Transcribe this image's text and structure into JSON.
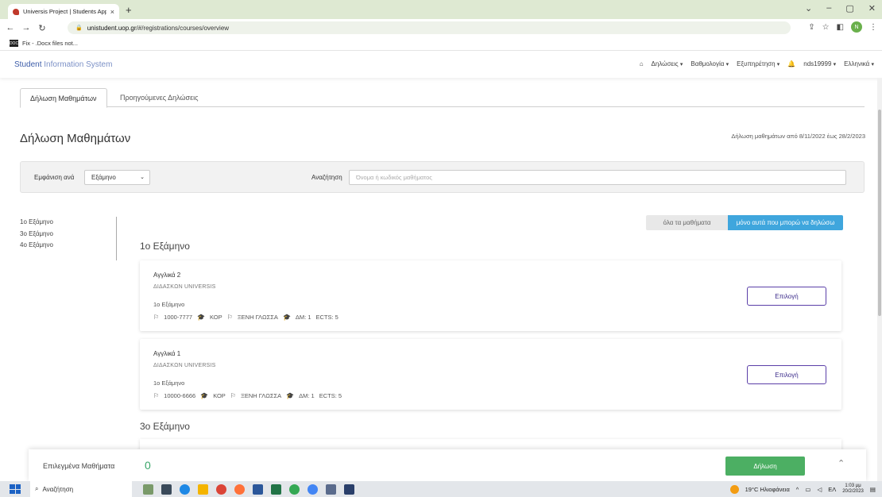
{
  "browser": {
    "tab_title": "Universis Project | Students Appl",
    "tab_close": "×",
    "new_tab": "+",
    "url_host": "unistudent.uop.gr",
    "url_path": "/#/registrations/courses/overview",
    "bookmark_label": "Fix - .Docx files not...",
    "bookmark_icon_text": "DOC",
    "profile_initial": "N",
    "win_minimize": "–",
    "win_restore": "▢",
    "win_close": "✕"
  },
  "header": {
    "brand_primary": "Student",
    "brand_secondary": " Information System",
    "nav": [
      {
        "label": "Δηλώσεις"
      },
      {
        "label": "Βαθμολογία"
      },
      {
        "label": "Εξυπηρέτηση"
      }
    ],
    "user": "nds19999",
    "language": "Ελληνικά"
  },
  "tabs": [
    {
      "label": "Δήλωση Μαθημάτων"
    },
    {
      "label": "Προηγούμενες Δηλώσεις"
    }
  ],
  "page": {
    "title": "Δήλωση Μαθημάτων",
    "period": "Δήλωση μαθημάτων από 8/11/2022 έως 28/2/2023"
  },
  "filters": {
    "show_by_label": "Εμφάνιση ανά",
    "show_by_value": "Εξάμηνο",
    "search_label": "Αναζήτηση",
    "search_placeholder": "Όνομα ή κωδικός μαθήματος"
  },
  "semester_nav": [
    "1ο Εξάμηνο",
    "3ο Εξάμηνο",
    "4ο Εξάμηνο"
  ],
  "toggle": {
    "all": "όλα τα μαθήματα",
    "can_register": "μόνο αυτά που μπορώ να δηλώσω"
  },
  "sections": [
    {
      "heading": "1ο Εξάμηνο",
      "courses": [
        {
          "name": "Αγγλικά 2",
          "teacher": "ΔΙΔΑΣΚΩΝ UNIVERSIS",
          "semester": "1ο Εξάμηνο",
          "code": "1000-7777",
          "type": "ΚΟΡ",
          "category": "ΞΕΝΗ ΓΛΩΣΣΑ",
          "units": "ΔΜ: 1",
          "ects": "ECTS: 5",
          "button": "Επιλογή"
        },
        {
          "name": "Αγγλικά 1",
          "teacher": "ΔΙΔΑΣΚΩΝ UNIVERSIS",
          "semester": "1ο Εξάμηνο",
          "code": "10000-6666",
          "type": "ΚΟΡ",
          "category": "ΞΕΝΗ ΓΛΩΣΣΑ",
          "units": "ΔΜ: 1",
          "ects": "ECTS: 5",
          "button": "Επιλογή"
        }
      ]
    },
    {
      "heading": "3ο Εξάμηνο",
      "courses": []
    }
  ],
  "selection_bar": {
    "label": "Επιλεγμένα Μαθήματα",
    "count": "0",
    "submit": "Δήλωση"
  },
  "taskbar": {
    "search": "Αναζήτηση",
    "weather": "19°C Ηλιοφάνεια",
    "lang": "ΕΛ",
    "time": "1:03 μμ",
    "date": "20/2/2023"
  },
  "colors": {
    "brand": "#3b5ba8",
    "toggle_active": "#3fa6dd",
    "submit": "#4caf63",
    "select_button_border": "#5b3fa8"
  }
}
